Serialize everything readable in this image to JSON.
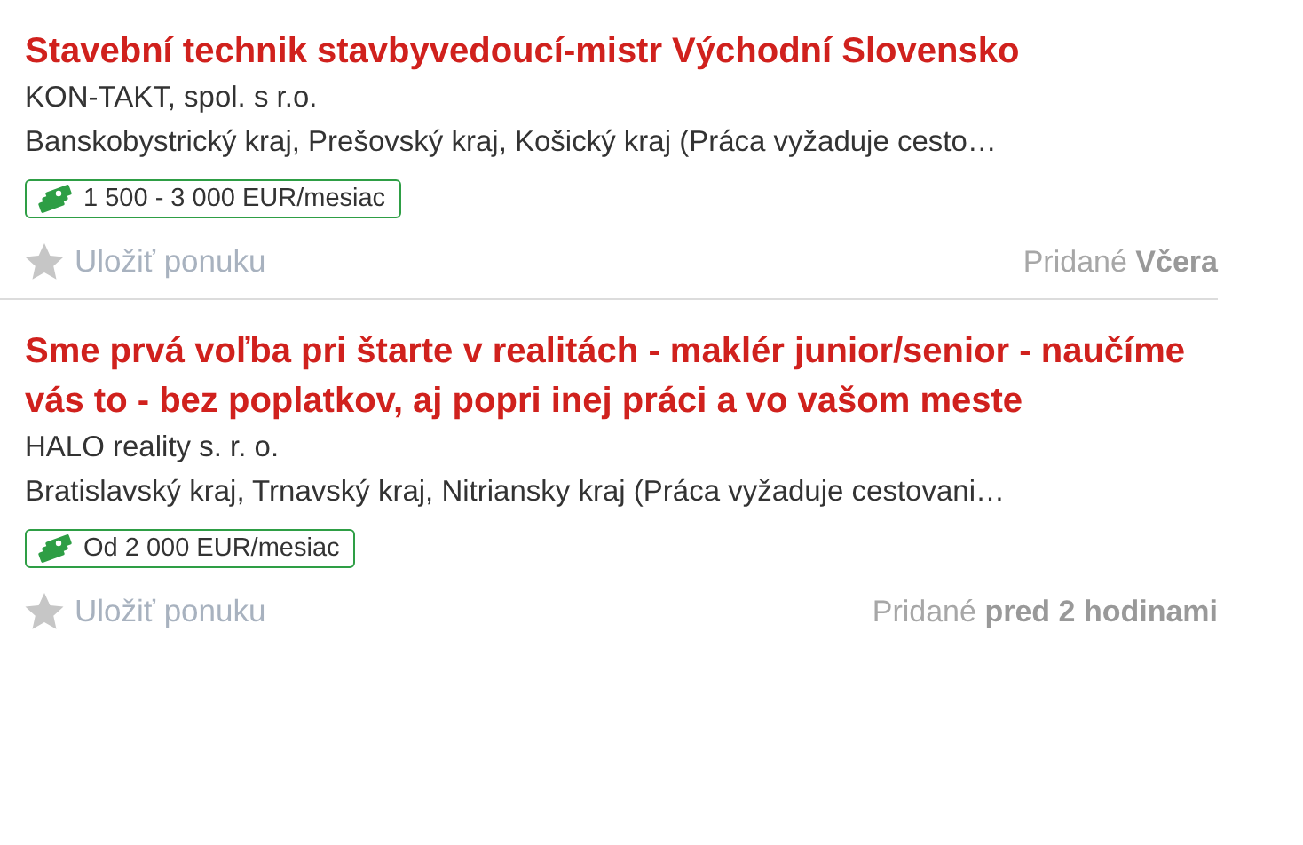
{
  "jobs": [
    {
      "title": "Stavební technik stavbyvedoucí-mistr Východní Slovensko",
      "company": "KON-TAKT, spol. s r.o.",
      "location": "Banskobystrický kraj, Prešovský kraj, Košický kraj (Práca vyžaduje cesto…",
      "salary": "1 500 - 3 000 EUR/mesiac",
      "save": "Uložiť ponuku",
      "added": "Pridané **Včera**"
    },
    {
      "title": "Sme prvá voľba pri štarte v realitách - maklér junior/senior - naučíme vás to - bez poplatkov, aj popri inej práci a vo vašom meste",
      "company": "HALO reality s. r. o.",
      "location": "Bratislavský kraj, Trnavský kraj, Nitriansky kraj (Práca vyžaduje cestovani…",
      "salary": "Od 2 000 EUR/mesiac",
      "save": "Uložiť ponuku",
      "added": "Pridané **pred 2 hodinami**"
    }
  ]
}
